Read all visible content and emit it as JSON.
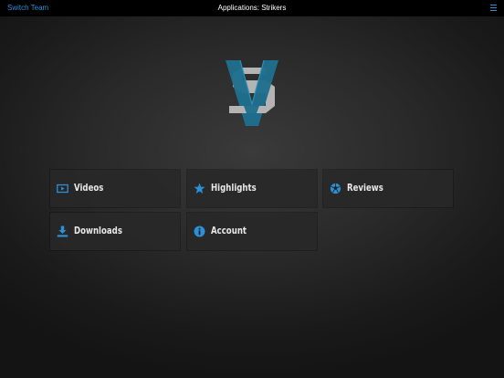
{
  "header": {
    "switch_team_label": "Switch Team",
    "title": "Applications: Strikers",
    "menu_icon": "hamburger-menu-icon"
  },
  "logo": {
    "letters": "VS"
  },
  "tiles": [
    {
      "label": "Videos",
      "icon": "video-play-icon"
    },
    {
      "label": "Highlights",
      "icon": "star-icon"
    },
    {
      "label": "Reviews",
      "icon": "soccer-ball-icon"
    },
    {
      "label": "Downloads",
      "icon": "download-icon"
    },
    {
      "label": "Account",
      "icon": "info-icon"
    }
  ],
  "colors": {
    "accent": "#2d8fd4",
    "topbar": "#000000",
    "tile_bg": "#282828",
    "tile_text": "#e8e8e8",
    "logo_grey": "#b4b4b4"
  }
}
